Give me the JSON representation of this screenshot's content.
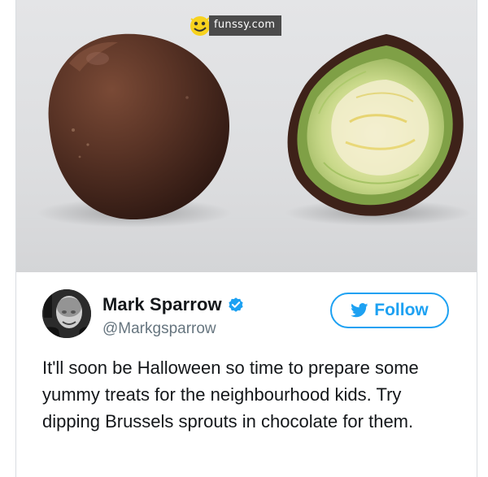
{
  "watermark": {
    "site": "funssy.com"
  },
  "photo": {
    "subject_left": "chocolate covered brussels sprout",
    "subject_right": "halved chocolate covered brussels sprout"
  },
  "tweet": {
    "author_name": "Mark Sparrow",
    "handle": "@Markgsparrow",
    "verified": true,
    "follow_label": "Follow",
    "text": "It'll soon be Halloween so time to prepare some yummy treats for the neighbourhood kids. Try dipping Brussels sprouts in chocolate for them."
  },
  "colors": {
    "twitter_blue": "#1da1f2",
    "text": "#14171a",
    "secondary_text": "#66757f",
    "chocolate": "#4a2a1e"
  },
  "icons": {
    "verified": "verified-badge-icon",
    "follow": "twitter-bird-icon",
    "watermark_logo": "funssy-logo-icon"
  }
}
